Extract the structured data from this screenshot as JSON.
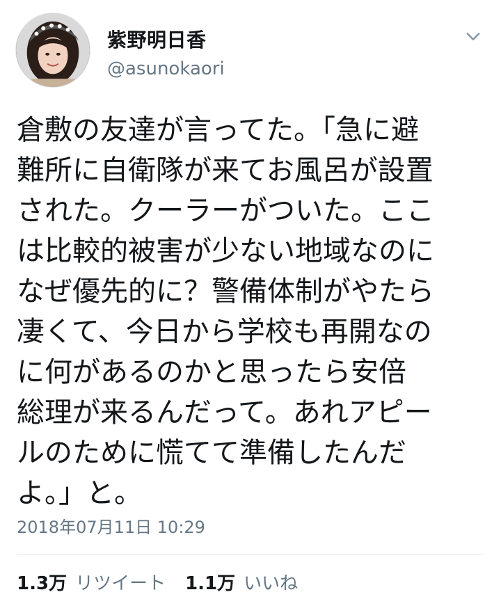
{
  "user": {
    "display_name": "紫野明日香",
    "handle": "@asunokaori"
  },
  "tweet": {
    "lines": [
      "倉敷の友達が言ってた。「急に避",
      "難所に自衛隊が来てお風呂が設置",
      "された。クーラーがついた。ここ",
      "は比較的被害が少ない地域なのに",
      "なぜ優先的に？警備体制がやたら",
      "凄くて、今日から学校も再開なの",
      "に何があるのかと思ったら安倍",
      "総理が来るんだって。あれアピー",
      "ルのために慌てて準備したんだ",
      "よ。」と。"
    ],
    "timestamp": "2018年07月11日 10:29"
  },
  "stats": {
    "retweets_count": "1.3万",
    "retweets_label": "リツイート",
    "likes_count": "1.1万",
    "likes_label": "いいね"
  },
  "icons": {
    "menu": "chevron-down-icon",
    "avatar": "profile-avatar"
  },
  "colors": {
    "text": "#14171a",
    "secondary": "#657786",
    "divider": "#e1e8ed"
  }
}
